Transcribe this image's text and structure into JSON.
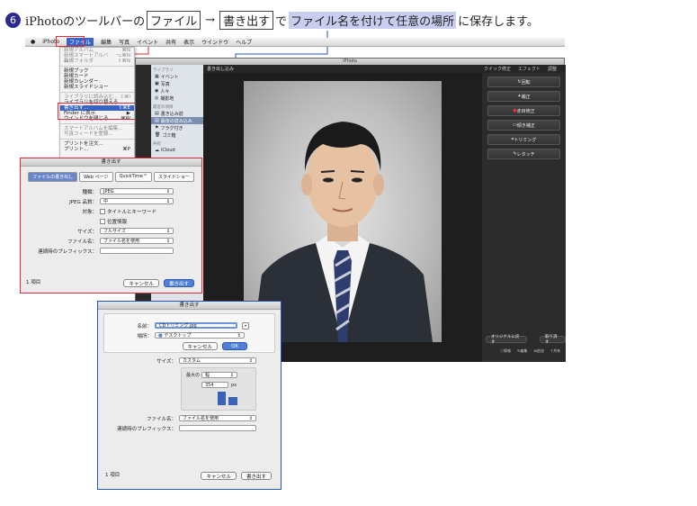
{
  "instruction": {
    "step": "6",
    "pre": "iPhotoのツールバーの",
    "file": "ファイル",
    "arrow": "→",
    "export": "書き出す",
    "de": "で",
    "highlight": "ファイル名を付けて任意の場所",
    "post": "に保存します。"
  },
  "menubar": {
    "items": [
      "iPhoto",
      "ファイル",
      "編集",
      "写真",
      "イベント",
      "共有",
      "表示",
      "ウインドウ",
      "ヘルプ"
    ]
  },
  "file_menu": {
    "items": [
      {
        "label": "新規アルバム",
        "shortcut": "⌘N",
        "state": "dim"
      },
      {
        "label": "新規スマートアルバム...",
        "shortcut": "⌥⌘N",
        "state": "dim"
      },
      {
        "label": "新規フォルダ",
        "shortcut": "⇧⌘N",
        "state": "dim"
      },
      {
        "label": "新規ブック",
        "shortcut": "",
        "state": "normal"
      },
      {
        "label": "新規カード",
        "shortcut": "",
        "state": "normal"
      },
      {
        "label": "新規カレンダー",
        "shortcut": "",
        "state": "normal"
      },
      {
        "label": "新規スライドショー",
        "shortcut": "",
        "state": "normal"
      },
      {
        "label": "ライブラリに読み込む...",
        "shortcut": "⇧⌘I",
        "state": "dim"
      },
      {
        "label": "ライブラリを切り替える...",
        "shortcut": "",
        "state": "normal"
      },
      {
        "label": "書き出す...",
        "shortcut": "⇧⌘E",
        "state": "sel"
      },
      {
        "label": "Finder に表示",
        "shortcut": "▶",
        "state": "normal"
      },
      {
        "label": "ウインドウを閉じる",
        "shortcut": "⌘W",
        "state": "normal"
      },
      {
        "label": "スマートアルバムを編集...",
        "shortcut": "",
        "state": "dim"
      },
      {
        "label": "写真フィードを登録...",
        "shortcut": "",
        "state": "dim"
      },
      {
        "label": "プリントを注文...",
        "shortcut": "",
        "state": "normal"
      },
      {
        "label": "プリント...",
        "shortcut": "⌘P",
        "state": "normal"
      }
    ]
  },
  "iphoto": {
    "title": "iPhoto",
    "album_title": "書き出し込み",
    "sidebar": {
      "library_header": "ライブラリ",
      "library_items": [
        "イベント",
        "写真",
        "人々",
        "撮影地"
      ],
      "recent_header": "最近の項目",
      "recent_items": [
        "書き込み前",
        "最後の読み込み",
        "フラグ付き",
        "ゴミ箱"
      ],
      "shared_header": "共有",
      "shared_items": [
        "iCloud"
      ]
    },
    "tabs": [
      "クイック修正",
      "エフェクト",
      "調整"
    ],
    "quick_fix": [
      "回転",
      "補正",
      "赤目修正",
      "傾き補正",
      "トリミング",
      "レタッチ"
    ],
    "bottom_left": "オリジナルに戻す",
    "bottom_right": "取り消す",
    "toolbar_bottom": [
      "情報",
      "編集",
      "追加",
      "共有"
    ]
  },
  "export_dialog": {
    "title": "書き出す",
    "tabs": [
      "ファイルの書き出し",
      "Web ページ",
      "QuickTime™",
      "スライドショー"
    ],
    "kind_label": "種類：",
    "kind_value": "JPEG",
    "quality_label": "JPEG 品質：",
    "quality_value": "中",
    "include_label": "対象：",
    "include_title": "タイトルとキーワード",
    "include_location": "位置情報",
    "size_label": "サイズ：",
    "size_value": "フルサイズ",
    "filename_label": "ファイル名：",
    "filename_value": "ファイル名を使用",
    "prefix_label": "連続時のプレフィックス：",
    "count": "1 項目",
    "cancel": "キャンセル",
    "export": "書き出す"
  },
  "save_dialog": {
    "title": "書き出す",
    "name_label": "名前：",
    "name_value": "CDトリミング.jpg",
    "where_label": "場所：",
    "where_value": "デスクトップ",
    "cancel": "キャンセル",
    "ok": "OK",
    "size_label": "サイズ：",
    "size_value": "カスタム",
    "max_label": "最大の",
    "max_value": "幅",
    "px_value": "354",
    "px_unit": "px",
    "filename_label": "ファイル名：",
    "filename_value": "ファイル名を使用",
    "prefix_label": "連続時のプレフィックス：",
    "count": "1 項目",
    "cancel2": "キャンセル",
    "export": "書き出す"
  },
  "colors": {
    "red_callout": "#e02a3a",
    "blue_callout": "#1e56c4",
    "highlight": "#c9cdef",
    "menu_select": "#3864c8"
  }
}
